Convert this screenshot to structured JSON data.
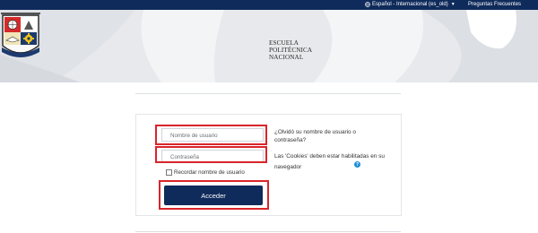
{
  "topnav": {
    "language": "Español - Internacional (es_old)",
    "faq": "Preguntas Frecuentes",
    "icons": {
      "language": "globe-icon",
      "language_menu": "caret-down-icon"
    }
  },
  "logo": {
    "lines": [
      "ESCUELA",
      "POLITÉCNICA",
      "NACIONAL"
    ]
  },
  "login": {
    "username_placeholder": "Nombre de usuario",
    "password_placeholder": "Contraseña",
    "remember_label": "Recordar nombre de usuario",
    "submit_label": "Acceder",
    "forgot_text": "¿Olvidó su nombre de usuario o contraseña?",
    "cookies_text": "Las 'Cookies' deben estar habilitadas en su navegador",
    "help_icon": "question-circle-icon"
  },
  "colors": {
    "navy": "#0f2b5b",
    "highlight_red": "#d9252b",
    "help_blue": "#1d8fd6"
  }
}
